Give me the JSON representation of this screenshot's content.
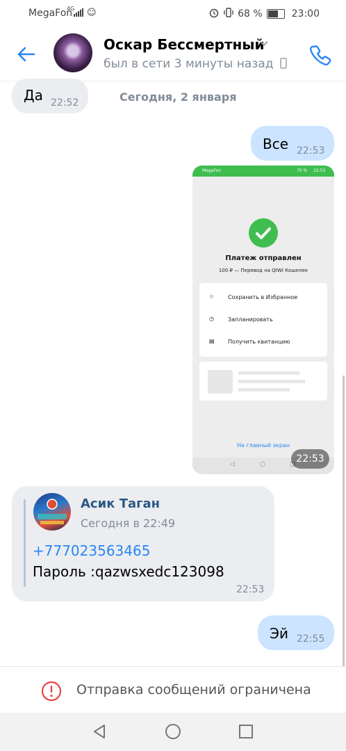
{
  "status_bar": {
    "carrier": "MegaFon",
    "network": "4G",
    "battery": "68 %",
    "battery_level": 0.68,
    "time": "23:00"
  },
  "header": {
    "contact_name": "Оскар Бессмертный",
    "last_seen": "был в сети 3 минуты назад",
    "icons": [
      "back-arrow-icon",
      "chevron-down-icon",
      "mobile-device-icon",
      "phone-icon"
    ]
  },
  "date_separator": "Сегодня, 2 января",
  "messages": [
    {
      "direction": "in",
      "text": "Да",
      "time": "22:52"
    },
    {
      "direction": "out",
      "text": "Все",
      "time": "22:53"
    },
    {
      "direction": "out",
      "type": "photo",
      "time": "22:53"
    },
    {
      "direction": "in",
      "type": "forwarded",
      "author": "Асик Таган",
      "author_time": "Сегодня в 22:49",
      "phone": "+777023563465",
      "text": "Пароль :qazwsxedc123098",
      "time": "22:53"
    },
    {
      "direction": "out",
      "text": "Эй",
      "time": "22:55"
    }
  ],
  "screenshot": {
    "carrier": "MegaFon",
    "battery": "70 %",
    "time": "22:53",
    "title": "Платеж отправлен",
    "subtitle": "100 ₽ — Перевод на QIWI Кошелек",
    "actions": [
      "Сохранить в Избранное",
      "Запланировать",
      "Получить квитанцию"
    ],
    "home_link": "На главный экран"
  },
  "footer": {
    "restriction_text": "Отправка сообщений ограничена",
    "icons": [
      "alert-circle-icon"
    ]
  },
  "nav_bar": {
    "icons": [
      "back-triangle-icon",
      "home-circle-icon",
      "recents-square-icon"
    ]
  },
  "colors": {
    "accent": "#2787f5",
    "incoming_bubble": "#ebedf0",
    "outgoing_bubble": "#cce4ff",
    "alert": "#e64646",
    "payment_green": "#3fbd4f"
  }
}
